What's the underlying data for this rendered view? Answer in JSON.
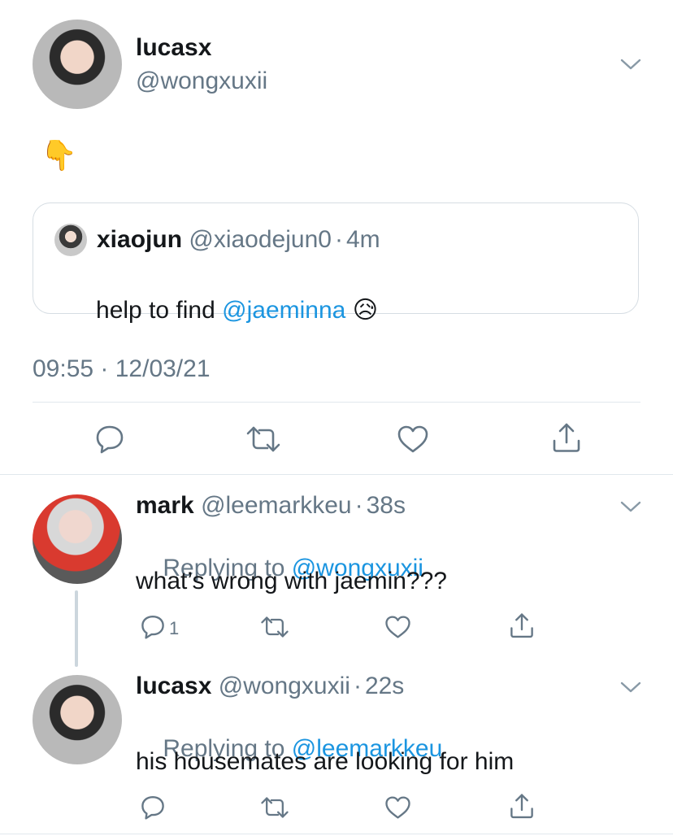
{
  "main_tweet": {
    "display_name": "lucasx",
    "handle": "@wongxuxii",
    "body_emoji": "👇",
    "quoted": {
      "display_name": "xiaojun",
      "handle": "@xiaodejun0",
      "time": "4m",
      "text_prefix": "help to find ",
      "mention": "@jaeminna",
      "emoji": "😥"
    },
    "timestamp": "09:55 · 12/03/21"
  },
  "replies": [
    {
      "display_name": "mark",
      "handle": "@leemarkkeu",
      "time": "38s",
      "replying_prefix": "Replying to ",
      "replying_to": "@wongxuxii",
      "text": "what’s wrong with jaemin???",
      "reply_count": "1"
    },
    {
      "display_name": "lucasx",
      "handle": "@wongxuxii",
      "time": "22s",
      "replying_prefix": "Replying to ",
      "replying_to": "@leemarkkeu",
      "text": "his housemates are looking for him",
      "reply_count": ""
    }
  ],
  "separator": "·",
  "icons": [
    "chevron-down-icon",
    "reply-icon",
    "retweet-icon",
    "like-icon",
    "share-icon",
    "pointing-down-emoji",
    "sad-relieved-emoji"
  ],
  "colors": {
    "link": "#1b95e0",
    "secondary_text": "#657786",
    "divider": "#e1e8ed",
    "thread_line": "#ccd6dd"
  }
}
